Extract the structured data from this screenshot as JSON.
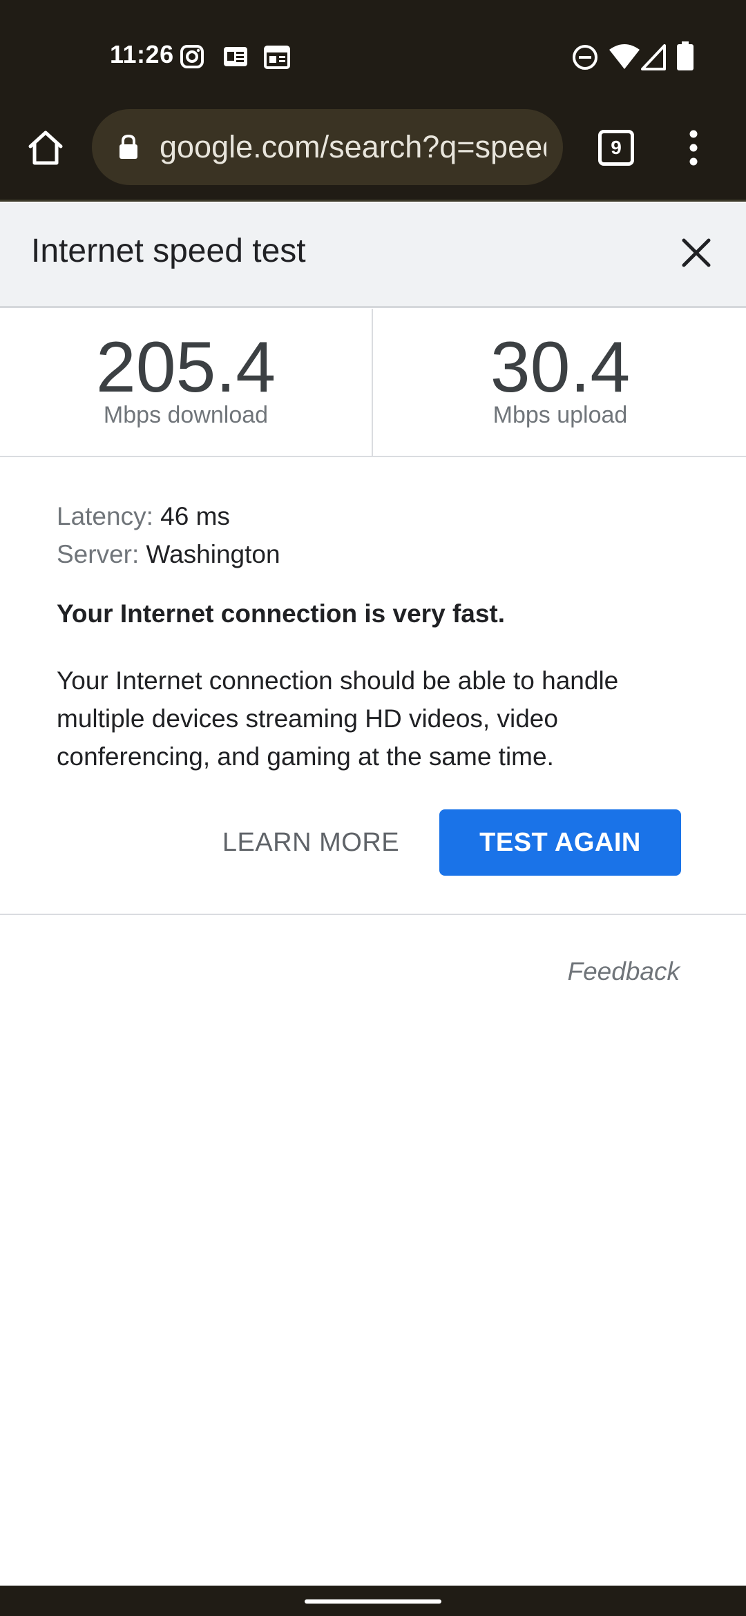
{
  "status_bar": {
    "time": "11:26",
    "notification_icons": [
      "instagram-icon",
      "news-card-icon",
      "calendar-icon"
    ],
    "system_icons": [
      "do-not-disturb-icon",
      "wifi-icon",
      "cellular-signal-icon",
      "battery-icon"
    ]
  },
  "browser": {
    "url": "google.com/search?q=speed",
    "tab_count": "9"
  },
  "speed_test": {
    "title": "Internet speed test",
    "download_value": "205.4",
    "download_label": "Mbps download",
    "upload_value": "30.4",
    "upload_label": "Mbps upload",
    "latency_label": "Latency:",
    "latency_value": "46 ms",
    "server_label": "Server:",
    "server_value": "Washington",
    "verdict": "Your Internet connection is very fast.",
    "description": "Your Internet connection should be able to handle multiple devices streaming HD videos, video conferencing, and gaming at the same time.",
    "learn_more_label": "LEARN MORE",
    "test_again_label": "TEST AGAIN",
    "feedback_label": "Feedback"
  },
  "colors": {
    "chrome_bg": "#201c15",
    "omnibox_bg": "#3a3323",
    "accent_blue": "#1a73e8"
  }
}
